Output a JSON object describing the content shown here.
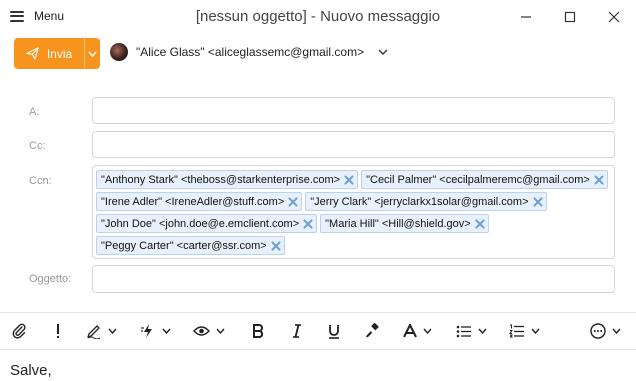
{
  "window": {
    "menu_label": "Menu",
    "title": "[nessun oggetto] - Nuovo messaggio"
  },
  "compose": {
    "send_label": "Invia",
    "from": "\"Alice Glass\" <aliceglassemc@gmail.com>"
  },
  "fields": {
    "to_label": "A:",
    "cc_label": "Cc:",
    "bcc_label": "Ccn:",
    "subject_label": "Oggetto:",
    "bcc_recipients": [
      "\"Anthony Stark\" <theboss@starkenterprise.com>",
      "\"Cecil Palmer\" <cecilpalmeremc@gmail.com>",
      "\"Irene Adler\" <IreneAdler@stuff.com>",
      "\"Jerry Clark\" <jerryclarkx1solar@gmail.com>",
      "\"John Doe\" <john.doe@e.emclient.com>",
      "\"Maria Hill\" <Hill@shield.gov>",
      "\"Peggy Carter\" <carter@ssr.com>"
    ]
  },
  "body": {
    "text": "Salve,"
  },
  "colors": {
    "accent": "#f7941d",
    "chip_bg": "#e8f1fb",
    "chip_border": "#b9d3ee"
  }
}
